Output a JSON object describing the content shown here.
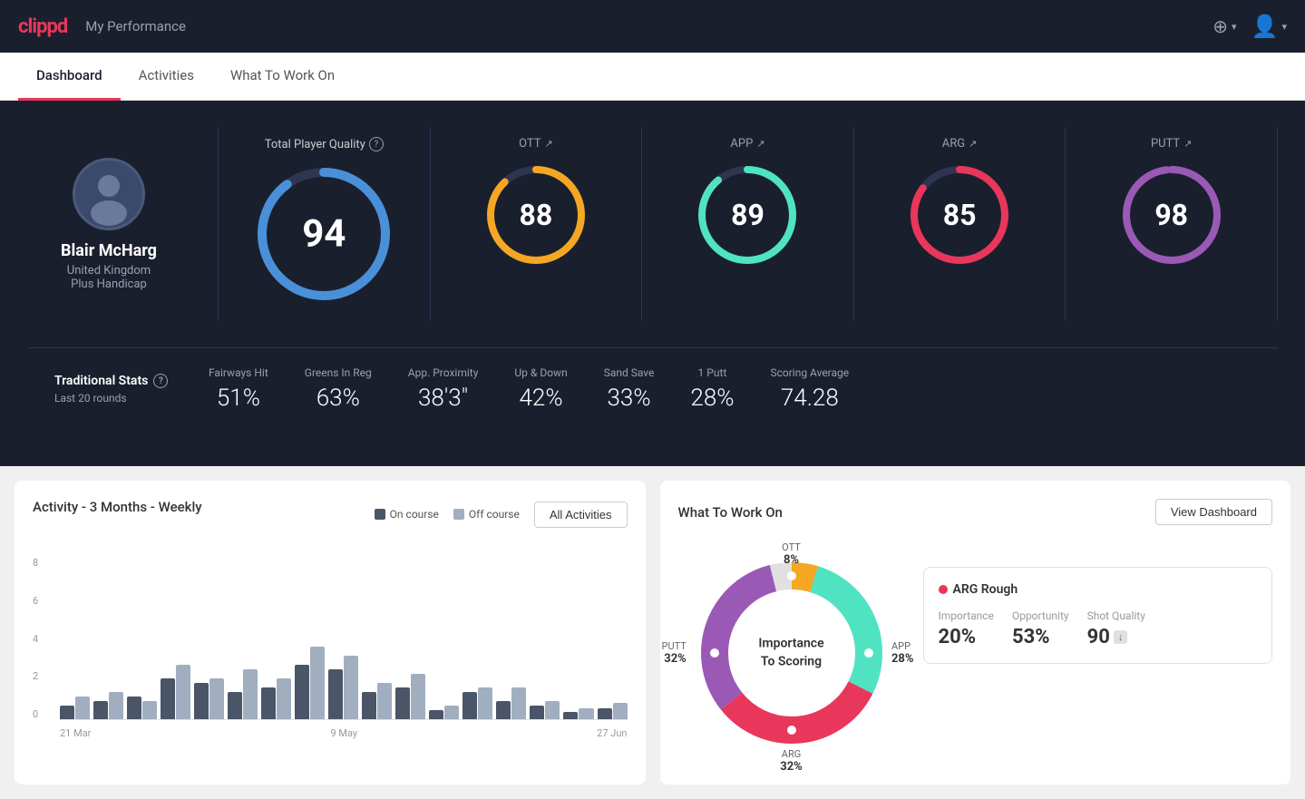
{
  "header": {
    "logo": "clippd",
    "title": "My Performance",
    "add_icon": "⊕",
    "user_icon": "👤"
  },
  "tabs": [
    {
      "id": "dashboard",
      "label": "Dashboard",
      "active": true
    },
    {
      "id": "activities",
      "label": "Activities",
      "active": false
    },
    {
      "id": "what-to-work-on",
      "label": "What To Work On",
      "active": false
    }
  ],
  "player": {
    "name": "Blair McHarg",
    "country": "United Kingdom",
    "handicap": "Plus Handicap",
    "avatar_emoji": "🧑"
  },
  "scores": {
    "total_label": "Total Player Quality",
    "total_value": "94",
    "total_color": "#4a90d9",
    "items": [
      {
        "id": "ott",
        "label": "OTT",
        "value": "88",
        "color": "#f5a623",
        "pct": 88
      },
      {
        "id": "app",
        "label": "APP",
        "value": "89",
        "color": "#50e3c2",
        "pct": 89
      },
      {
        "id": "arg",
        "label": "ARG",
        "value": "85",
        "color": "#e8375a",
        "pct": 85
      },
      {
        "id": "putt",
        "label": "PUTT",
        "value": "98",
        "color": "#9b59b6",
        "pct": 98
      }
    ]
  },
  "traditional_stats": {
    "title": "Traditional Stats",
    "subtitle": "Last 20 rounds",
    "items": [
      {
        "label": "Fairways Hit",
        "value": "51%"
      },
      {
        "label": "Greens In Reg",
        "value": "63%"
      },
      {
        "label": "App. Proximity",
        "value": "38'3\""
      },
      {
        "label": "Up & Down",
        "value": "42%"
      },
      {
        "label": "Sand Save",
        "value": "33%"
      },
      {
        "label": "1 Putt",
        "value": "28%"
      },
      {
        "label": "Scoring Average",
        "value": "74.28"
      }
    ]
  },
  "activity_chart": {
    "title": "Activity - 3 Months - Weekly",
    "legend": {
      "on_course": "On course",
      "off_course": "Off course"
    },
    "button": "All Activities",
    "y_labels": [
      "0",
      "2",
      "4",
      "6",
      "8"
    ],
    "x_labels": [
      "21 Mar",
      "9 May",
      "27 Jun"
    ],
    "bars": [
      {
        "dark": 15,
        "light": 25
      },
      {
        "dark": 20,
        "light": 30
      },
      {
        "dark": 25,
        "light": 20
      },
      {
        "dark": 45,
        "light": 50
      },
      {
        "dark": 40,
        "light": 45
      },
      {
        "dark": 30,
        "light": 55
      },
      {
        "dark": 35,
        "light": 45
      },
      {
        "dark": 55,
        "light": 70
      },
      {
        "dark": 50,
        "light": 65
      },
      {
        "dark": 30,
        "light": 40
      },
      {
        "dark": 35,
        "light": 50
      },
      {
        "dark": 10,
        "light": 15
      },
      {
        "dark": 25,
        "light": 30
      },
      {
        "dark": 20,
        "light": 35
      },
      {
        "dark": 15,
        "light": 20
      },
      {
        "dark": 8,
        "light": 10
      },
      {
        "dark": 12,
        "light": 18
      }
    ]
  },
  "what_to_work_on": {
    "title": "What To Work On",
    "button": "View Dashboard",
    "donut_center": "Importance\nTo Scoring",
    "segments": [
      {
        "label": "OTT",
        "value": "8%",
        "color": "#f5a623",
        "position": "top"
      },
      {
        "label": "APP",
        "value": "28%",
        "color": "#50e3c2",
        "position": "right"
      },
      {
        "label": "ARG",
        "value": "32%",
        "color": "#e8375a",
        "position": "bottom"
      },
      {
        "label": "PUTT",
        "value": "32%",
        "color": "#9b59b6",
        "position": "left"
      }
    ],
    "detail": {
      "title": "ARG Rough",
      "dot_color": "#e8375a",
      "metrics": [
        {
          "label": "Importance",
          "value": "20%"
        },
        {
          "label": "Opportunity",
          "value": "53%"
        },
        {
          "label": "Shot Quality",
          "value": "90",
          "badge": "↓"
        }
      ]
    }
  },
  "colors": {
    "background_dark": "#1a1f2e",
    "accent_red": "#e8375a",
    "text_muted": "#9aa0b0"
  }
}
